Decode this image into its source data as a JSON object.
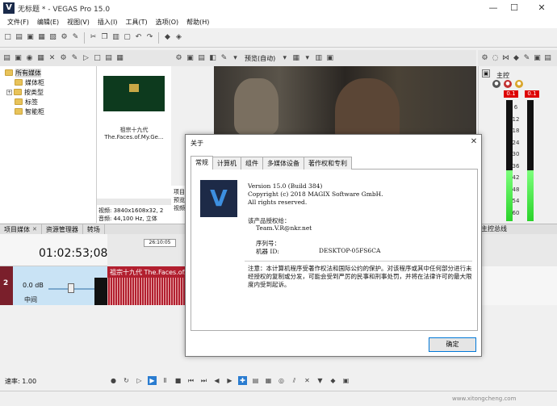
{
  "window": {
    "title": "无标题 * - VEGAS Pro 15.0",
    "logo": "V",
    "minimize": "—",
    "maximize": "☐",
    "close": "✕"
  },
  "menu": [
    "文件(F)",
    "编辑(E)",
    "视图(V)",
    "插入(I)",
    "工具(T)",
    "选项(O)",
    "帮助(H)"
  ],
  "media": {
    "tree": [
      {
        "label": "所有媒体",
        "level": 0,
        "selected": true
      },
      {
        "label": "媒体柜",
        "level": 1
      },
      {
        "label": "按类型",
        "level": 1,
        "expander": "+"
      },
      {
        "label": "标签",
        "level": 1
      },
      {
        "label": "智能柜",
        "level": 1
      }
    ],
    "item_name_line1": "祖宗十九代",
    "item_name_line2": "The.Faces.of.My.Ge...",
    "info_line1": "视频: 3840x1608x32, 2",
    "info_line2": "音频: 44,100 Hz, 立体"
  },
  "middle_strip": {
    "line1": "项目",
    "line2": "预览",
    "line3": "视频"
  },
  "left_tabs": [
    {
      "label": "项目媒体",
      "close": "✕"
    },
    {
      "label": "资源管理器",
      "close": ""
    },
    {
      "label": "转场",
      "close": ""
    }
  ],
  "preview": {
    "quality": "预览(自动)"
  },
  "mixer": {
    "label": "主控",
    "peak_left": "0.1",
    "peak_right": "0.1",
    "scale": [
      "6",
      "12",
      "18",
      "24",
      "30",
      "36",
      "42",
      "48",
      "54",
      "60"
    ],
    "bottom_tab": "主控总线",
    "level_left": 0.42,
    "level_right": 0.42
  },
  "timeline": {
    "timecode": "01:02:53;08",
    "marker": "26:10:05",
    "track_number": "2",
    "track_volume": "0.0 dB",
    "track_pan": "中间",
    "clip_title": "祖宗十九代 The.Faces.of.My.Ge",
    "rate": "速率: 1.00"
  },
  "dialog": {
    "title": "关于",
    "close": "✕",
    "tabs": [
      "常规",
      "计算机",
      "组件",
      "多媒体设备",
      "著作权和专利"
    ],
    "active_tab": 0,
    "logo": "V",
    "version": "Version 15.0 (Build 384)",
    "copyright": "Copyright (c) 2018 MAGIX Software GmbH.",
    "rights": "All rights reserved.",
    "licensed_to_label": "该产品授权给：",
    "licensed_to": "Team.V.R@nkr.net",
    "serial_label": "序列号：",
    "machine_label": "机器 ID:",
    "machine_id": "DESKTOP-05FS6CA",
    "warning": "注意：本计算机程序受著作权法和国际公约的保护。对该程序或其中任何部分进行未经授权的复制或分发，可能会受到严厉的民事和刑事处罚，并将在法律许可的最大限度内受到起诉。",
    "ok": "确定"
  },
  "watermark": "www.xitongcheng.com"
}
